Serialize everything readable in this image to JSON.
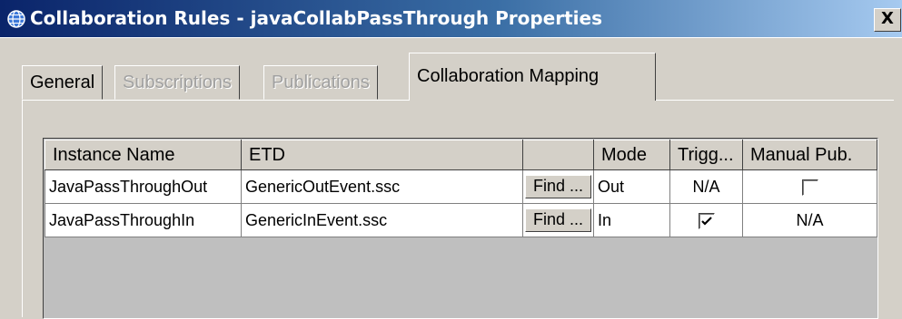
{
  "window": {
    "title": "Collaboration Rules - javaCollabPassThrough Properties",
    "close_label": "X",
    "icon": "globe-icon"
  },
  "tabs": [
    {
      "label": "General",
      "state": "normal"
    },
    {
      "label": "Subscriptions",
      "state": "disabled"
    },
    {
      "label": "Publications",
      "state": "disabled"
    },
    {
      "label": "Collaboration Mapping",
      "state": "active"
    }
  ],
  "table": {
    "columns": [
      "Instance Name",
      "ETD",
      "",
      "Mode",
      "Trigg...",
      "Manual Pub."
    ],
    "rows": [
      {
        "instance_name": "JavaPassThroughOut",
        "etd": "GenericOutEvent.ssc",
        "find_label": "Find ...",
        "mode": "Out",
        "trigger": "N/A",
        "manual_pub": false
      },
      {
        "instance_name": "JavaPassThroughIn",
        "etd": "GenericInEvent.ssc",
        "find_label": "Find ...",
        "mode": "In",
        "trigger": true,
        "manual_pub": "N/A"
      }
    ]
  },
  "colors": {
    "titlebar_start": "#0a246a",
    "titlebar_end": "#a6caf0",
    "dialog_bg": "#d4d0c8",
    "empty_table_bg": "#bfbfbf"
  }
}
